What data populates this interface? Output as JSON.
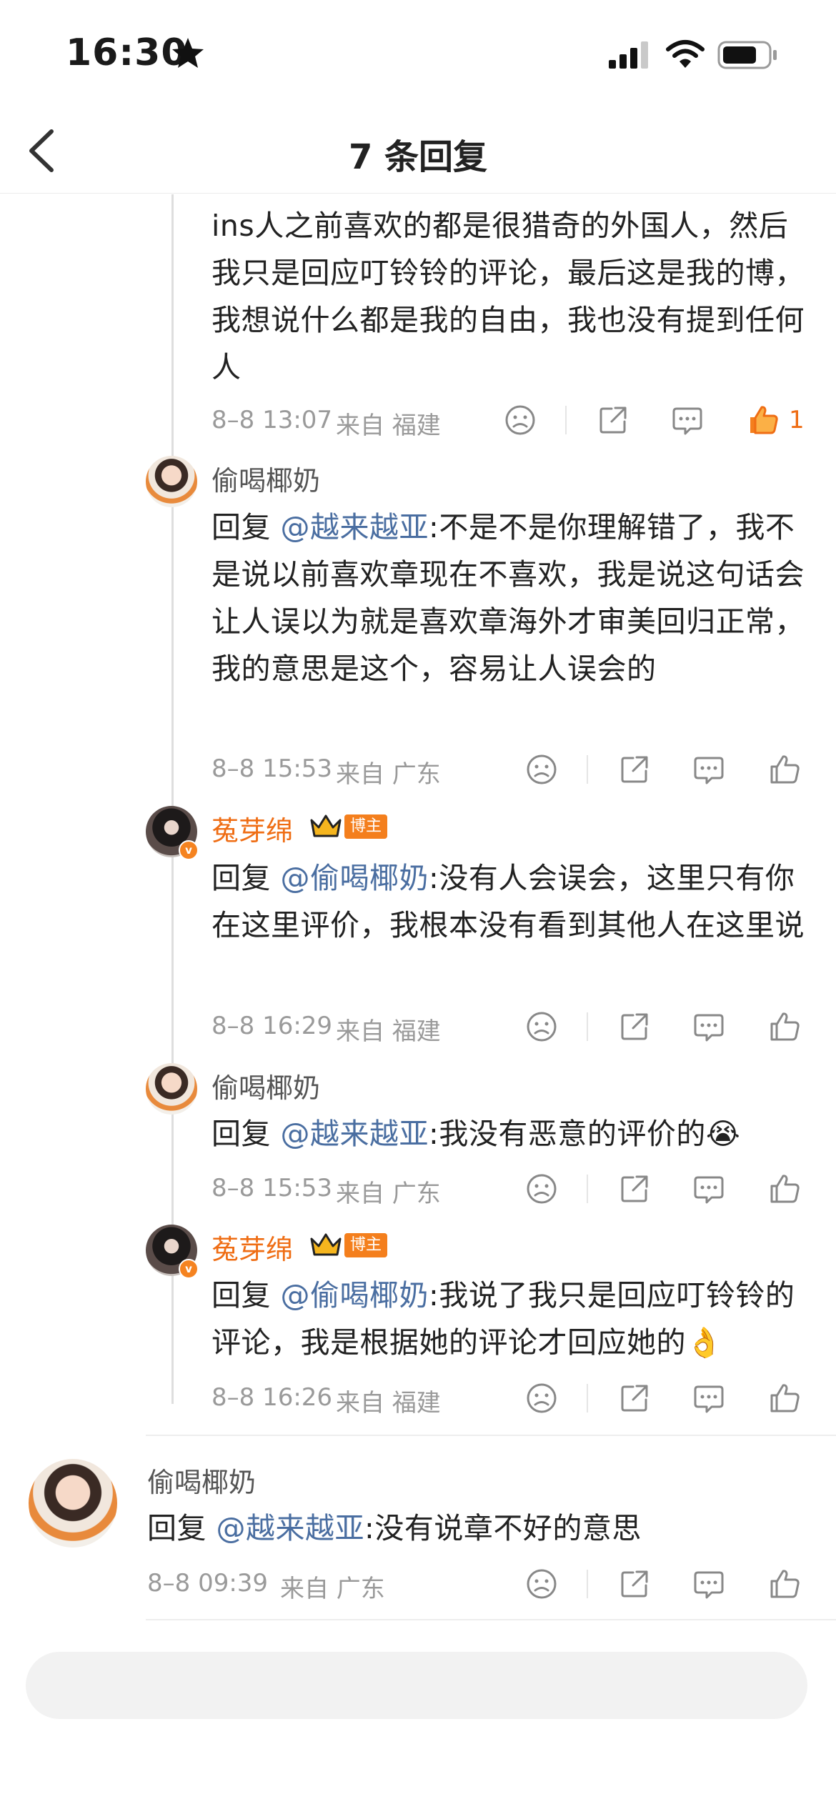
{
  "status": {
    "time": "16:30"
  },
  "header": {
    "title": "7 条回复"
  },
  "comments": [
    {
      "text": "ins人之前喜欢的都是很猎奇的外国人，然后我只是回应叮铃铃的评论，最后这是我的博，我想说什么都是我的自由，我也没有提到任何人",
      "date": "8–8 13:07",
      "from": "来自 福建",
      "likes": "1"
    },
    {
      "user": "偷喝椰奶",
      "reply_prefix": "回复 ",
      "mention": "@越来越亚",
      "text": ":不是不是你理解错了，我不是说以前喜欢章现在不喜欢，我是说这句话会让人误以为就是喜欢章海外才审美回归正常，我的意思是这个，容易让人误会的",
      "date": "8–8 15:53",
      "from": "来自 广东"
    },
    {
      "user": "菟芽绵",
      "badge": "博主",
      "reply_prefix": "回复 ",
      "mention": "@偷喝椰奶",
      "text": ":没有人会误会，这里只有你在这里评价，我根本没有看到其他人在这里说",
      "date": "8–8 16:29",
      "from": "来自 福建"
    },
    {
      "user": "偷喝椰奶",
      "reply_prefix": "回复 ",
      "mention": "@越来越亚",
      "text": ":我没有恶意的评价的😭",
      "date": "8–8 15:53",
      "from": "来自 广东"
    },
    {
      "user": "菟芽绵",
      "badge": "博主",
      "reply_prefix": "回复 ",
      "mention": "@偷喝椰奶",
      "text": ":我说了我只是回应叮铃铃的评论，我是根据她的评论才回应她的👌",
      "date": "8–8 16:26",
      "from": "来自 福建"
    },
    {
      "user": "偷喝椰奶",
      "reply_prefix": "回复 ",
      "mention": "@越来越亚",
      "text": ":没有说章不好的意思",
      "date": "8–8 09:39",
      "from": "来自 广东"
    }
  ],
  "colors": {
    "accent_orange": "#ef6d14",
    "mention_blue": "#4a6ea1",
    "meta_gray": "#9a9a9a"
  }
}
